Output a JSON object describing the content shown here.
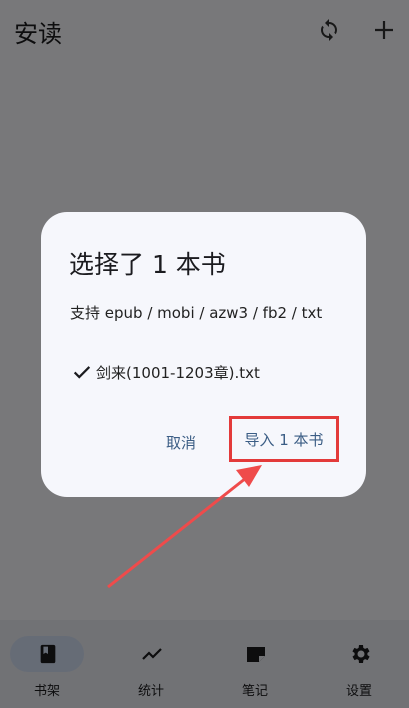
{
  "app": {
    "title": "安读",
    "sync_icon": "sync-icon",
    "add_icon": "plus-icon"
  },
  "bottom_nav": {
    "items": [
      {
        "label": "书架",
        "icon": "book-icon",
        "active": true
      },
      {
        "label": "统计",
        "icon": "chart-icon",
        "active": false
      },
      {
        "label": "笔记",
        "icon": "note-icon",
        "active": false
      },
      {
        "label": "设置",
        "icon": "gear-icon",
        "active": false
      }
    ]
  },
  "dialog": {
    "title": "选择了 1 本书",
    "support_text": "支持 epub / mobi / azw3 / fb2 / txt",
    "file_name": "剑来(1001-1203章).txt",
    "cancel_label": "取消",
    "import_label": "导入 1 本书"
  },
  "colors": {
    "accent": "#3b5d85",
    "highlight": "#e33a3a",
    "active_nav": "#d6e2f7"
  }
}
